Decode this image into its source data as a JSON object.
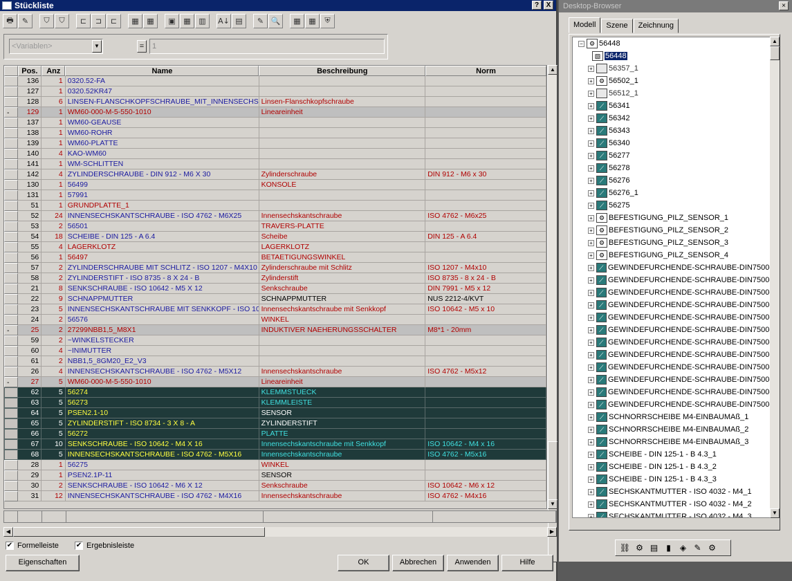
{
  "window": {
    "title": "Stückliste",
    "help_btn": "?",
    "close_btn": "X"
  },
  "toolbar": [
    "🖶",
    "✎",
    "⛉",
    "⛉",
    "⊏",
    "⊐",
    "⊏",
    "▦",
    "▦",
    "▣",
    "▦",
    "▥",
    "A↓",
    "▤",
    "✎",
    "🔍",
    "▦",
    "▦",
    "⛨"
  ],
  "filter": {
    "variable_placeholder": "<Variablen>",
    "eq": "=",
    "value": "1"
  },
  "columns": [
    "Pos.",
    "Anz",
    "Name",
    "Beschreibung",
    "Norm"
  ],
  "rows": [
    {
      "m": "",
      "pos": "136",
      "anz": "1",
      "name": "0320.52-FA",
      "desc": "",
      "norm": "",
      "t": "n",
      "nc": "#1a1aa0",
      "dc": "#b00000"
    },
    {
      "m": "",
      "pos": "127",
      "anz": "1",
      "name": "0320.52KR47",
      "desc": "",
      "norm": "",
      "t": "n",
      "nc": "#1a1aa0",
      "dc": "#b00000"
    },
    {
      "m": "",
      "pos": "128",
      "anz": "6",
      "name": "LINSEN-FLANSCHKOPFSCHRAUBE_MIT_INNENSECHS",
      "desc": "Linsen-Flanschkopfschraube",
      "norm": "",
      "t": "n",
      "nc": "#1a1aa0",
      "dc": "#b00000"
    },
    {
      "m": "-",
      "pos": "129",
      "anz": "1",
      "name": "WM60-000-M-5-550-1010",
      "desc": "Lineareinheit",
      "norm": "",
      "t": "l",
      "nc": "#b00000",
      "dc": "#b00000"
    },
    {
      "m": "",
      "pos": "137",
      "anz": "1",
      "name": "WM60-GEAUSE",
      "desc": "",
      "norm": "",
      "t": "n",
      "nc": "#1a1aa0",
      "dc": "#b00000"
    },
    {
      "m": "",
      "pos": "138",
      "anz": "1",
      "name": "WM60-ROHR",
      "desc": "",
      "norm": "",
      "t": "n",
      "nc": "#1a1aa0",
      "dc": "#b00000"
    },
    {
      "m": "",
      "pos": "139",
      "anz": "1",
      "name": "WM60-PLATTE",
      "desc": "",
      "norm": "",
      "t": "n",
      "nc": "#1a1aa0",
      "dc": "#b00000"
    },
    {
      "m": "",
      "pos": "140",
      "anz": "4",
      "name": "KAO-WM60",
      "desc": "",
      "norm": "",
      "t": "n",
      "nc": "#1a1aa0",
      "dc": "#b00000"
    },
    {
      "m": "",
      "pos": "141",
      "anz": "1",
      "name": "WM-SCHLITTEN",
      "desc": "",
      "norm": "",
      "t": "n",
      "nc": "#1a1aa0",
      "dc": "#b00000"
    },
    {
      "m": "",
      "pos": "142",
      "anz": "4",
      "name": "ZYLINDERSCHRAUBE - DIN 912 - M6 X 30",
      "desc": "Zylinderschraube",
      "norm": "DIN 912 - M6 x 30",
      "t": "n",
      "nc": "#1a1aa0",
      "dc": "#b00000"
    },
    {
      "m": "",
      "pos": "130",
      "anz": "1",
      "name": "56499",
      "desc": "KONSOLE",
      "norm": "",
      "t": "n",
      "nc": "#1a1aa0",
      "dc": "#b00000"
    },
    {
      "m": "",
      "pos": "131",
      "anz": "1",
      "name": "57991",
      "desc": "",
      "norm": "",
      "t": "n",
      "nc": "#1a1aa0",
      "dc": "#b00000"
    },
    {
      "m": "",
      "pos": "51",
      "anz": "1",
      "name": "GRUNDPLATTE_1",
      "desc": "",
      "norm": "",
      "t": "n",
      "nc": "#b00000",
      "dc": "#b00000"
    },
    {
      "m": "",
      "pos": "52",
      "anz": "24",
      "name": "INNENSECHSKANTSCHRAUBE - ISO 4762 - M6X25",
      "desc": "Innensechskantschraube",
      "norm": "ISO 4762 - M6x25",
      "t": "n",
      "nc": "#1a1aa0",
      "dc": "#b00000"
    },
    {
      "m": "",
      "pos": "53",
      "anz": "2",
      "name": "56501",
      "desc": "TRAVERS-PLATTE",
      "norm": "",
      "t": "n",
      "nc": "#1a1aa0",
      "dc": "#b00000"
    },
    {
      "m": "",
      "pos": "54",
      "anz": "18",
      "name": "SCHEIBE - DIN 125 - A 6.4",
      "desc": "Scheibe",
      "norm": "DIN 125 - A 6.4",
      "t": "n",
      "nc": "#1a1aa0",
      "dc": "#b00000"
    },
    {
      "m": "",
      "pos": "55",
      "anz": "4",
      "name": "LAGERKLOTZ",
      "desc": "LAGERKLOTZ",
      "norm": "",
      "t": "n",
      "nc": "#b00000",
      "dc": "#b00000"
    },
    {
      "m": "",
      "pos": "56",
      "anz": "1",
      "name": "56497",
      "desc": "BETAETIGUNGSWINKEL",
      "norm": "",
      "t": "n",
      "nc": "#b00000",
      "dc": "#b00000"
    },
    {
      "m": "",
      "pos": "57",
      "anz": "2",
      "name": "ZYLINDERSCHRAUBE MIT SCHLITZ - ISO 1207 - M4X10",
      "desc": "Zylinderschraube mit Schlitz",
      "norm": "ISO 1207 - M4x10",
      "t": "n",
      "nc": "#1a1aa0",
      "dc": "#b00000"
    },
    {
      "m": "",
      "pos": "58",
      "anz": "2",
      "name": "ZYLINDERSTIFT - ISO 8735 - 8 X 24 - B",
      "desc": "Zylinderstift",
      "norm": "ISO 8735 - 8 x 24 - B",
      "t": "n",
      "nc": "#1a1aa0",
      "dc": "#b00000"
    },
    {
      "m": "",
      "pos": "21",
      "anz": "8",
      "name": "SENKSCHRAUBE - ISO 10642 - M5 X 12",
      "desc": "Senkschraube",
      "norm": "DIN 7991 - M5 x 12",
      "t": "n",
      "nc": "#1a1aa0",
      "dc": "#b00000"
    },
    {
      "m": "",
      "pos": "22",
      "anz": "9",
      "name": "SCHNAPPMUTTER",
      "desc": "SCHNAPPMUTTER",
      "norm": "NUS 2212-4/KVT",
      "t": "n",
      "nc": "#1a1aa0",
      "dc": "#000000"
    },
    {
      "m": "",
      "pos": "23",
      "anz": "5",
      "name": "INNENSECHSKANTSCHRAUBE MIT SENKKOPF - ISO 10642",
      "desc": "Innensechskantschraube mit Senkkopf",
      "norm": "ISO 10642 - M5 x 10",
      "t": "n",
      "nc": "#1a1aa0",
      "dc": "#b00000"
    },
    {
      "m": "",
      "pos": "24",
      "anz": "2",
      "name": "56576",
      "desc": "WINKEL",
      "norm": "",
      "t": "n",
      "nc": "#1a1aa0",
      "dc": "#b00000"
    },
    {
      "m": "-",
      "pos": "25",
      "anz": "2",
      "name": "27299NBB1,5_M8X1",
      "desc": "INDUKTIVER NAEHERUNGSSCHALTER",
      "norm": "M8*1 - 20mm",
      "t": "l",
      "nc": "#b00000",
      "dc": "#b00000"
    },
    {
      "m": "",
      "pos": "59",
      "anz": "2",
      "name": "~WINKELSTECKER",
      "desc": "",
      "norm": "",
      "t": "n",
      "nc": "#1a1aa0",
      "dc": "#b00000"
    },
    {
      "m": "",
      "pos": "60",
      "anz": "4",
      "name": "~INIMUTTER",
      "desc": "",
      "norm": "",
      "t": "n",
      "nc": "#1a1aa0",
      "dc": "#b00000"
    },
    {
      "m": "",
      "pos": "61",
      "anz": "2",
      "name": "NBB1,5_8GM20_E2_V3",
      "desc": "",
      "norm": "",
      "t": "n",
      "nc": "#1a1aa0",
      "dc": "#b00000"
    },
    {
      "m": "",
      "pos": "26",
      "anz": "4",
      "name": "INNENSECHSKANTSCHRAUBE - ISO 4762 - M5X12",
      "desc": "Innensechskantschraube",
      "norm": "ISO 4762 - M5x12",
      "t": "n",
      "nc": "#1a1aa0",
      "dc": "#b00000"
    },
    {
      "m": "-",
      "pos": "27",
      "anz": "5",
      "name": "WM60-000-M-5-550-1010",
      "desc": "Lineareinheit",
      "norm": "",
      "t": "l",
      "nc": "#b00000",
      "dc": "#b00000"
    },
    {
      "m": "",
      "pos": "62",
      "anz": "5",
      "name": "56274",
      "desc": "KLEMMSTUECK",
      "norm": "",
      "t": "d",
      "nc": "#ffff40",
      "dc": "#40e0e0"
    },
    {
      "m": "",
      "pos": "63",
      "anz": "5",
      "name": "56273",
      "desc": "KLEMMLEISTE",
      "norm": "",
      "t": "d",
      "nc": "#ffff40",
      "dc": "#40e0e0"
    },
    {
      "m": "",
      "pos": "64",
      "anz": "5",
      "name": "PSEN2.1-10",
      "desc": "SENSOR",
      "norm": "",
      "t": "d",
      "nc": "#ffff40",
      "dc": "#ffffff"
    },
    {
      "m": "",
      "pos": "65",
      "anz": "5",
      "name": "ZYLINDERSTIFT - ISO 8734 - 3 X 8 - A",
      "desc": "ZYLINDERSTIFT",
      "norm": "",
      "t": "d",
      "nc": "#ffff40",
      "dc": "#ffffff"
    },
    {
      "m": "",
      "pos": "66",
      "anz": "5",
      "name": "56272",
      "desc": "PLATTE",
      "norm": "",
      "t": "d",
      "nc": "#ffff40",
      "dc": "#40e0e0"
    },
    {
      "m": "",
      "pos": "67",
      "anz": "10",
      "name": "SENKSCHRAUBE - ISO 10642 - M4 X 16",
      "desc": "Innensechskantschraube mit Senkkopf",
      "norm": "ISO 10642 - M4 x 16",
      "t": "d",
      "nc": "#ffff40",
      "dc": "#40e0e0"
    },
    {
      "m": "",
      "pos": "68",
      "anz": "5",
      "name": "INNENSECHSKANTSCHRAUBE - ISO 4762 - M5X16",
      "desc": "Innensechskantschraube",
      "norm": "ISO 4762 - M5x16",
      "t": "d",
      "nc": "#ffff40",
      "dc": "#40e0e0"
    },
    {
      "m": "",
      "pos": "28",
      "anz": "1",
      "name": "56275",
      "desc": "WINKEL",
      "norm": "",
      "t": "n",
      "nc": "#1a1aa0",
      "dc": "#b00000"
    },
    {
      "m": "",
      "pos": "29",
      "anz": "1",
      "name": "PSEN2.1P-11",
      "desc": "SENSOR",
      "norm": "",
      "t": "n",
      "nc": "#1a1aa0",
      "dc": "#000000"
    },
    {
      "m": "",
      "pos": "30",
      "anz": "2",
      "name": "SENKSCHRAUBE - ISO 10642 - M6 X 12",
      "desc": "Senkschraube",
      "norm": "ISO 10642 - M6 x 12",
      "t": "n",
      "nc": "#1a1aa0",
      "dc": "#b00000"
    },
    {
      "m": "",
      "pos": "31",
      "anz": "12",
      "name": "INNENSECHSKANTSCHRAUBE - ISO 4762 - M4X16",
      "desc": "Innensechskantschraube",
      "norm": "ISO 4762 - M4x16",
      "t": "n",
      "nc": "#1a1aa0",
      "dc": "#b00000"
    }
  ],
  "checkboxes": [
    {
      "label": "Formelleiste",
      "checked": "✔"
    },
    {
      "label": "Ergebnisleiste",
      "checked": "✔"
    }
  ],
  "buttons": {
    "properties": "Eigenschaften",
    "ok": "OK",
    "cancel": "Abbrechen",
    "apply": "Anwenden",
    "help": "Hilfe"
  },
  "browser": {
    "title": "Desktop-Browser",
    "tabs": [
      "Modell",
      "Szene",
      "Zeichnung"
    ],
    "root": "56448",
    "selected": "56448",
    "nodes": [
      {
        "label": "56357_1",
        "k": "g"
      },
      {
        "label": "56502_1",
        "k": "a"
      },
      {
        "label": "56512_1",
        "k": "g"
      },
      {
        "label": "56341",
        "k": "p"
      },
      {
        "label": "56342",
        "k": "p"
      },
      {
        "label": "56343",
        "k": "p"
      },
      {
        "label": "56340",
        "k": "p"
      },
      {
        "label": "56277",
        "k": "p"
      },
      {
        "label": "56278",
        "k": "p"
      },
      {
        "label": "56276",
        "k": "p"
      },
      {
        "label": "56276_1",
        "k": "p"
      },
      {
        "label": "56275",
        "k": "p"
      },
      {
        "label": "BEFESTIGUNG_PILZ_SENSOR_1",
        "k": "a"
      },
      {
        "label": "BEFESTIGUNG_PILZ_SENSOR_2",
        "k": "a"
      },
      {
        "label": "BEFESTIGUNG_PILZ_SENSOR_3",
        "k": "a"
      },
      {
        "label": "BEFESTIGUNG_PILZ_SENSOR_4",
        "k": "a"
      },
      {
        "label": "GEWINDEFURCHENDE-SCHRAUBE-DIN7500-",
        "k": "p"
      },
      {
        "label": "GEWINDEFURCHENDE-SCHRAUBE-DIN7500-",
        "k": "p"
      },
      {
        "label": "GEWINDEFURCHENDE-SCHRAUBE-DIN7500-",
        "k": "p"
      },
      {
        "label": "GEWINDEFURCHENDE-SCHRAUBE-DIN7500-",
        "k": "p"
      },
      {
        "label": "GEWINDEFURCHENDE-SCHRAUBE-DIN7500-",
        "k": "p"
      },
      {
        "label": "GEWINDEFURCHENDE-SCHRAUBE-DIN7500-",
        "k": "p"
      },
      {
        "label": "GEWINDEFURCHENDE-SCHRAUBE-DIN7500-",
        "k": "p"
      },
      {
        "label": "GEWINDEFURCHENDE-SCHRAUBE-DIN7500-",
        "k": "p"
      },
      {
        "label": "GEWINDEFURCHENDE-SCHRAUBE-DIN7500-",
        "k": "p"
      },
      {
        "label": "GEWINDEFURCHENDE-SCHRAUBE-DIN7500-",
        "k": "p"
      },
      {
        "label": "GEWINDEFURCHENDE-SCHRAUBE-DIN7500-",
        "k": "p"
      },
      {
        "label": "GEWINDEFURCHENDE-SCHRAUBE-DIN7500-",
        "k": "p"
      },
      {
        "label": "SCHNORRSCHEIBE M4-EINBAUMAß_1",
        "k": "p"
      },
      {
        "label": "SCHNORRSCHEIBE M4-EINBAUMAß_2",
        "k": "p"
      },
      {
        "label": "SCHNORRSCHEIBE M4-EINBAUMAß_3",
        "k": "p"
      },
      {
        "label": "SCHEIBE - DIN 125-1 - B 4.3_1",
        "k": "p"
      },
      {
        "label": "SCHEIBE - DIN 125-1 - B 4.3_2",
        "k": "p"
      },
      {
        "label": "SCHEIBE - DIN 125-1 - B 4.3_3",
        "k": "p"
      },
      {
        "label": "SECHSKANTMUTTER - ISO 4032 - M4_1",
        "k": "p"
      },
      {
        "label": "SECHSKANTMUTTER - ISO 4032 - M4_2",
        "k": "p"
      },
      {
        "label": "SECHSKANTMUTTER - ISO 4032 - M4_3",
        "k": "p"
      }
    ],
    "tray": [
      "⛓",
      "⚙",
      "▤",
      "▮",
      "◈",
      "✎",
      "⚙"
    ]
  }
}
